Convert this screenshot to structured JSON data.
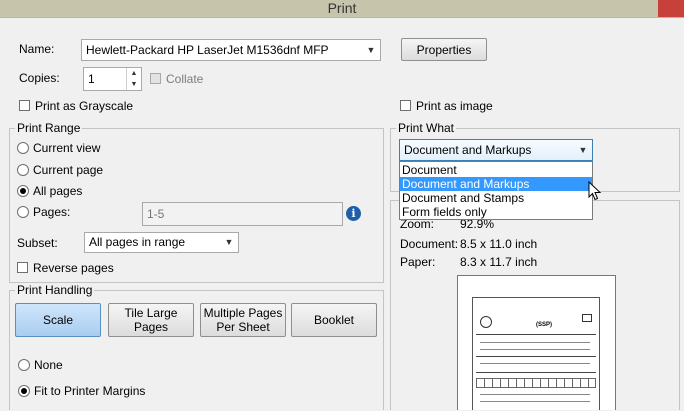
{
  "window": {
    "title": "Print"
  },
  "printer": {
    "name_label": "Name:",
    "selected": "Hewlett-Packard HP LaserJet M1536dnf MFP",
    "properties_label": "Properties",
    "copies_label": "Copies:",
    "copies_value": "1",
    "collate_label": "Collate",
    "grayscale_label": "Print as Grayscale",
    "print_as_image_label": "Print as image"
  },
  "print_range": {
    "legend": "Print Range",
    "options": [
      "Current view",
      "Current page",
      "All pages",
      "Pages:"
    ],
    "selected": "All pages",
    "pages_value": "1-5",
    "subset_label": "Subset:",
    "subset_value": "All pages in range",
    "reverse_label": "Reverse pages"
  },
  "print_handling": {
    "legend": "Print Handling",
    "buttons": [
      "Scale",
      "Tile Large Pages",
      "Multiple Pages Per Sheet",
      "Booklet"
    ],
    "active": "Scale",
    "scale_options": [
      "None",
      "Fit to Printer Margins"
    ],
    "scale_selected": "Fit to Printer Margins"
  },
  "print_what": {
    "legend": "Print What",
    "selected": "Document and Markups",
    "options": [
      "Document",
      "Document and Markups",
      "Document and Stamps",
      "Form fields only"
    ],
    "highlighted": "Document and Markups"
  },
  "preview": {
    "zoom_label": "Zoom:",
    "zoom_value": "92.9%",
    "document_label": "Document:",
    "document_value": "8.5 x 11.0 inch",
    "paper_label": "Paper:",
    "paper_value": "8.3 x 11.7 inch",
    "doc_heading": "(SSP)"
  }
}
